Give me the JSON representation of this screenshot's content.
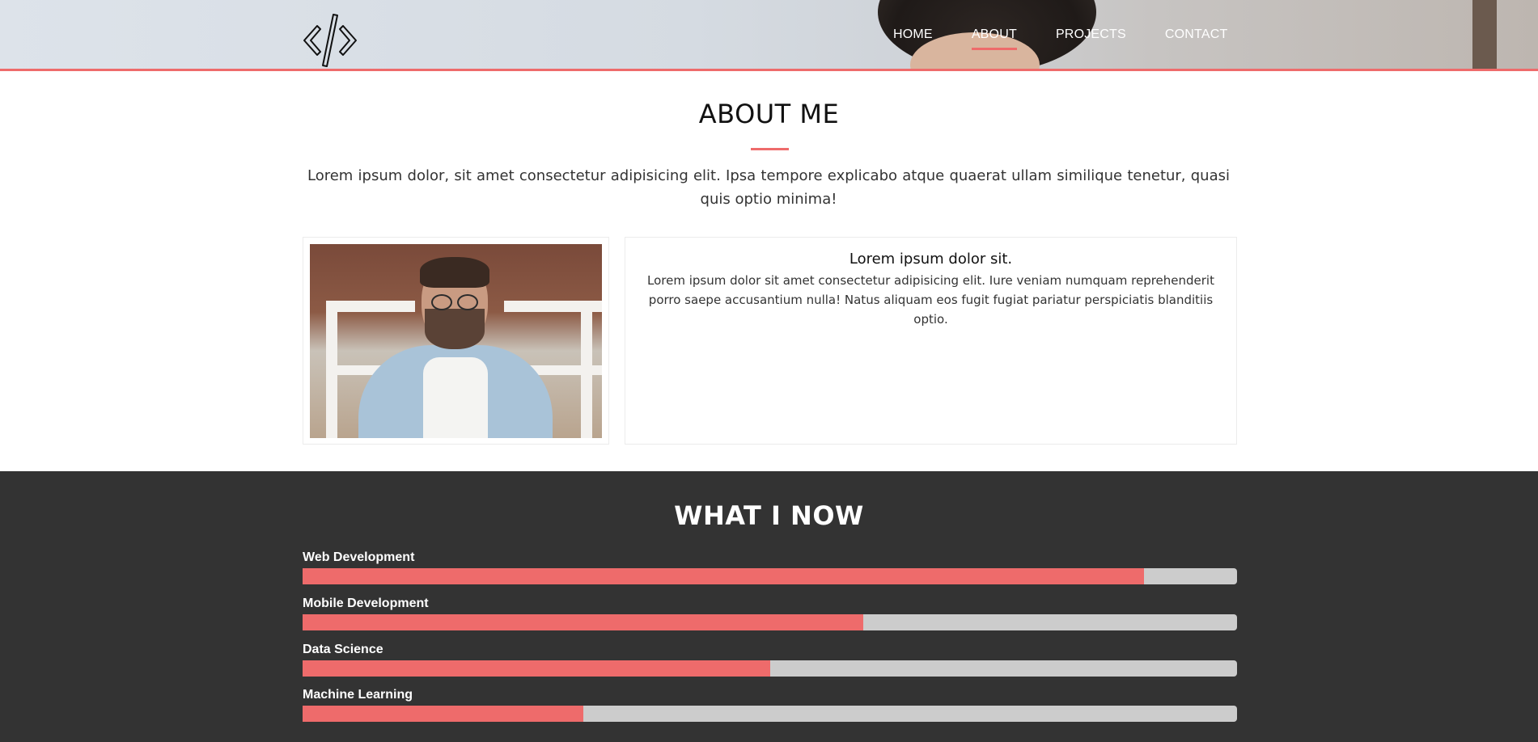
{
  "header": {
    "nav": [
      {
        "label": "HOME",
        "active": false
      },
      {
        "label": "ABOUT",
        "active": true
      },
      {
        "label": "PROJECTS",
        "active": false
      },
      {
        "label": "CONTACT",
        "active": false
      }
    ],
    "logo_icon": "code-brackets-icon",
    "accent_color": "#ee6b6b"
  },
  "about": {
    "title": "ABOUT ME",
    "intro": "Lorem ipsum dolor, sit amet consectetur adipisicing elit. Ipsa tempore explicabo atque quaerat ullam similique tenetur, quasi quis optio minima!",
    "card_heading": "Lorem ipsum dolor sit.",
    "card_text": "Lorem ipsum dolor sit amet consectetur adipisicing elit. Iure veniam numquam reprehenderit porro saepe accusantium nulla! Natus aliquam eos fugit fugiat pariatur perspiciatis blanditiis optio."
  },
  "skills": {
    "title": "WHAT I NOW",
    "background": "#333333",
    "items": [
      {
        "label": "Web Development",
        "level": 0.9
      },
      {
        "label": "Mobile Development",
        "level": 0.6
      },
      {
        "label": "Data Science",
        "level": 0.5
      },
      {
        "label": "Machine Learning",
        "level": 0.3
      }
    ]
  }
}
